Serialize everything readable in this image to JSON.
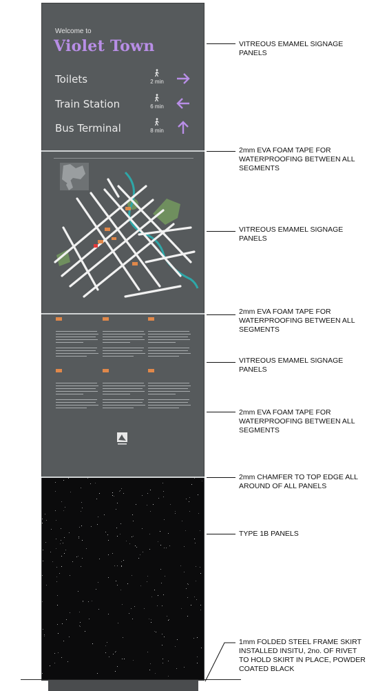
{
  "sign": {
    "welcome": "Welcome to",
    "town": "Violet Town",
    "destinations": [
      {
        "name": "Toilets",
        "time": "2 min",
        "arrow": "right"
      },
      {
        "name": "Train Station",
        "time": "6 min",
        "arrow": "left"
      },
      {
        "name": "Bus Terminal",
        "time": "8 min",
        "arrow": "up"
      }
    ],
    "accent_color": "#b88ee6",
    "panel_color": "#565a5c"
  },
  "annotations": [
    "VITREOUS EMAMEL SIGNAGE PANELS",
    "2mm EVA FOAM TAPE FOR WATERPROOFING BETWEEN ALL SEGMENTS",
    "VITREOUS EMAMEL SIGNAGE PANELS",
    "2mm EVA FOAM TAPE FOR WATERPROOFING BETWEEN ALL SEGMENTS",
    "VITREOUS EMAMEL SIGNAGE PANELS",
    "2mm EVA FOAM TAPE FOR WATERPROOFING BETWEEN ALL SEGMENTS",
    "2mm CHAMFER TO TOP EDGE ALL AROUND OF ALL PANELS",
    "TYPE 1B PANELS",
    "1mm FOLDED STEEL FRAME SKIRT INSTALLED INSITU, 2no. OF RIVET TO HOLD SKIRT IN PLACE, POWDER COATED BLACK"
  ]
}
